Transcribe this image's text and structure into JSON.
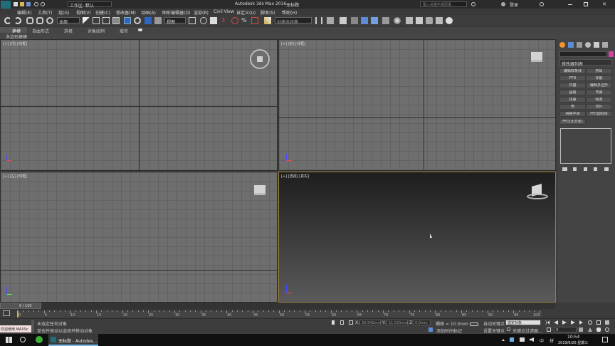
{
  "app": {
    "title_center": "Autodesk 3ds Max 2016",
    "doc_title": "无标题",
    "workspace_label": "工作区: 默认",
    "search_placeholder": "键入关键字或短语",
    "login": "登录"
  },
  "menu": [
    "编辑(E)",
    "工具(T)",
    "组(G)",
    "视图(V)",
    "创建(C)",
    "修改器(M)",
    "动画(A)",
    "图形编辑器(D)",
    "渲染(R)",
    "Civil View",
    "自定义(U)",
    "脚本(S)",
    "帮助(H)"
  ],
  "toolbar": {
    "filter_select": "全部",
    "ref_coord_select": "视图",
    "named_sel_select": "创建选择集"
  },
  "ribbon": {
    "tabs": [
      "建模",
      "自由形式",
      "选择",
      "对象绘制",
      "填充"
    ],
    "sub_label": "多边形建模"
  },
  "viewports": {
    "top": "[+] [顶] [线框]",
    "front": "[+] [前] [线框]",
    "left": "[+] [左] [线框]",
    "perspective": "[+] [透视] [真实]"
  },
  "cmd_panel": {
    "modifier_list": "修改器列表",
    "buttons": [
      [
        "编辑样条线",
        "挤出"
      ],
      [
        "FFD",
        "车削"
      ],
      [
        "扫描",
        "编辑多边形"
      ],
      [
        "晶格",
        "弯曲"
      ],
      [
        "扭曲",
        "噪波"
      ],
      [
        "壳",
        "切片"
      ],
      [
        "网格平滑",
        "FFD圆柱体"
      ]
    ],
    "extra_button": "FFD(长方体)"
  },
  "timeline": {
    "frame_counter": "0 / 100",
    "ticks": [
      "0",
      "5",
      "10",
      "15",
      "20",
      "25",
      "30",
      "35",
      "40",
      "45",
      "50",
      "55",
      "60",
      "65",
      "70",
      "75",
      "80",
      "85",
      "90",
      "95",
      "100"
    ]
  },
  "status": {
    "welcome": "欢迎使用 MAXSc",
    "line1": "未选定任何对象",
    "line2": "单击并拖动以选择并移动对象",
    "x_label": "X:",
    "x_value": "26.942mm",
    "y_label": "Y:",
    "y_value": "11.521mm",
    "z_label": "Z:",
    "z_value": "0.0mm",
    "grid": "栅格 = 10.0mm",
    "add_time_tag": "添加时间标记",
    "auto_key": "自动关键点",
    "selected_object": "选定对象",
    "set_key": "设置关键点",
    "key_filters": "关键点过滤器...",
    "frame_field": "0"
  },
  "taskbar": {
    "app_button": "无标题 - Autodes...",
    "time": "10:54",
    "date": "2019/6/26 星期三"
  },
  "colors": {
    "accent_blue": "#2b66c4",
    "magenta": "#d0449b",
    "key_red": "#b03030"
  }
}
